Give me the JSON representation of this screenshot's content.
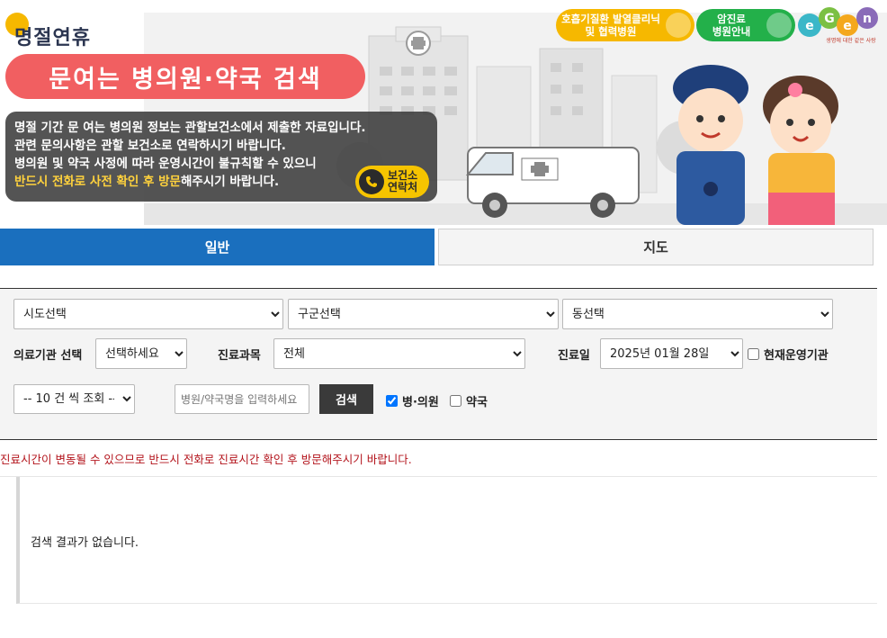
{
  "banner": {
    "logo_text": "명절연휴",
    "title": "문여는 병의원·약국 검색",
    "notice_line1": "명절 기간 문 여는 병의원 정보는 관할보건소에서 제출한 자료입니다.",
    "notice_line2": "관련 문의사항은 관할 보건소로 연락하시기 바랍니다.",
    "notice_line3": "병의원 및 약국 사정에 따라 운영시간이 불규칙할 수 있으니",
    "notice_line4_highlight": "반드시 전화로 사전 확인 후 방문",
    "notice_line4_rest": "해주시기 바랍니다.",
    "contact_line1": "보건소",
    "contact_line2": "연락처",
    "top_button_yellow_line1": "호흡기질환 발열클리닉",
    "top_button_yellow_line2": "및 협력병원",
    "top_button_green_line1": "암진료",
    "top_button_green_line2": "병원안내",
    "egen_tagline": "생명에 대한 같은 사랑"
  },
  "tabs": [
    {
      "label": "일반",
      "active": true
    },
    {
      "label": "지도",
      "active": false
    }
  ],
  "search": {
    "sido_value": "시도선택",
    "gugun_value": "구군선택",
    "dong_value": "동선택",
    "institution_label": "의료기관 선택",
    "institution_value": "선택하세요",
    "department_label": "진료과목",
    "department_value": "전체",
    "date_label": "진료일",
    "date_value": "2025년 01월 28일",
    "operating_now_label": "현재운영기관",
    "operating_now_checked": false,
    "page_size_value": "-- 10 건 씩 조회 --",
    "keyword_placeholder": "병원/약국명을 입력하세요",
    "search_button_label": "검색",
    "hospital_label": "병·의원",
    "hospital_checked": true,
    "pharmacy_label": "약국",
    "pharmacy_checked": false
  },
  "warning_text": "진료시간이 변동될 수 있으므로 반드시 전화로 진료시간 확인 후 방문해주시기 바랍니다.",
  "result": {
    "empty_message": "검색 결과가 없습니다."
  },
  "colors": {
    "tab_active": "#1a6fbe",
    "title_pill": "#f15f61",
    "warning": "#b3131b",
    "highlight": "#ffd23d"
  }
}
